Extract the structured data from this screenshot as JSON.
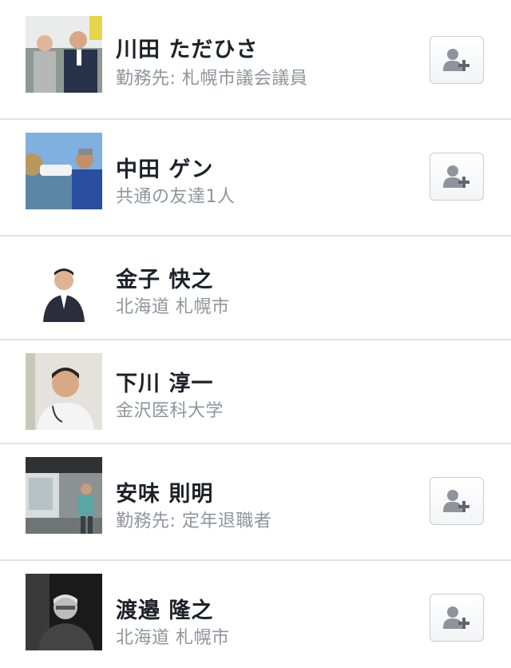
{
  "people": [
    {
      "name": "川田 ただひさ",
      "detail": "勤務先: 札幌市議会議員",
      "can_add": true
    },
    {
      "name": "中田 ゲン",
      "detail": "共通の友達1人",
      "can_add": true
    },
    {
      "name": "金子 快之",
      "detail": "北海道 札幌市",
      "can_add": false
    },
    {
      "name": "下川 淳一",
      "detail": "金沢医科大学",
      "can_add": false
    },
    {
      "name": "安味 則明",
      "detail": "勤務先: 定年退職者",
      "can_add": true
    },
    {
      "name": "渡邉 隆之",
      "detail": "北海道 札幌市",
      "can_add": true
    }
  ],
  "icons": {
    "add_friend": "add-friend-icon"
  }
}
